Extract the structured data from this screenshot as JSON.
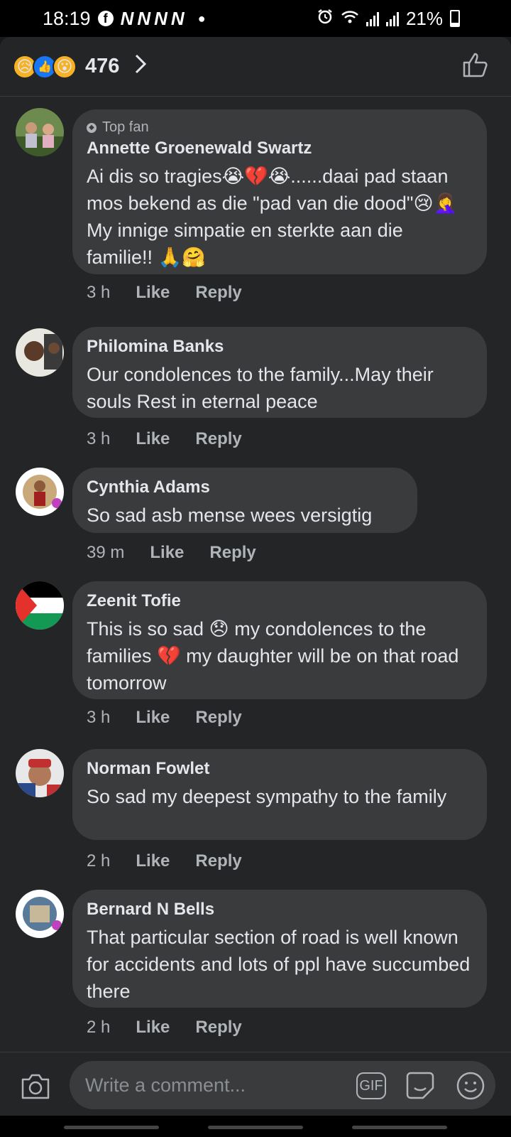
{
  "status_bar": {
    "time": "18:19",
    "notification_letters": [
      "N",
      "N",
      "N",
      "N"
    ],
    "battery": "21%",
    "battery_level": 0.21
  },
  "reactions": {
    "count": "476",
    "icons": [
      "sad-icon",
      "like-icon",
      "wow-icon"
    ]
  },
  "comments": [
    {
      "badge": "Top fan",
      "name": "Annette Groenewald Swartz",
      "text": "Ai dis so tragies😭💔😭......daai pad staan mos bekend as die \"pad van die dood\"😢🤦‍♀️ My innige simpatie en sterkte aan die familie!! 🙏🤗",
      "time": "3 h",
      "like": "Like",
      "reply": "Reply"
    },
    {
      "name": "Philomina Banks",
      "text": "Our condolences to the family...May their souls Rest in eternal peace",
      "time": "3 h",
      "like": "Like",
      "reply": "Reply"
    },
    {
      "name": "Cynthia Adams",
      "text": "So sad asb mense wees versigtig",
      "time": "39 m",
      "like": "Like",
      "reply": "Reply"
    },
    {
      "name": "Zeenit Tofie",
      "text": "This is so sad 😞 my condolences to the families 💔 my daughter will be on that road tomorrow",
      "time": "3 h",
      "like": "Like",
      "reply": "Reply"
    },
    {
      "name": "Norman Fowlet",
      "text": "So sad my deepest sympathy to the family",
      "time": "2 h",
      "like": "Like",
      "reply": "Reply"
    },
    {
      "name": "Bernard N Bells",
      "text": "That particular section of road is well known for accidents and lots of ppl have succumbed there",
      "time": "2 h",
      "like": "Like",
      "reply": "Reply"
    }
  ],
  "composer": {
    "placeholder": "Write a comment...",
    "gif_label": "GIF"
  }
}
